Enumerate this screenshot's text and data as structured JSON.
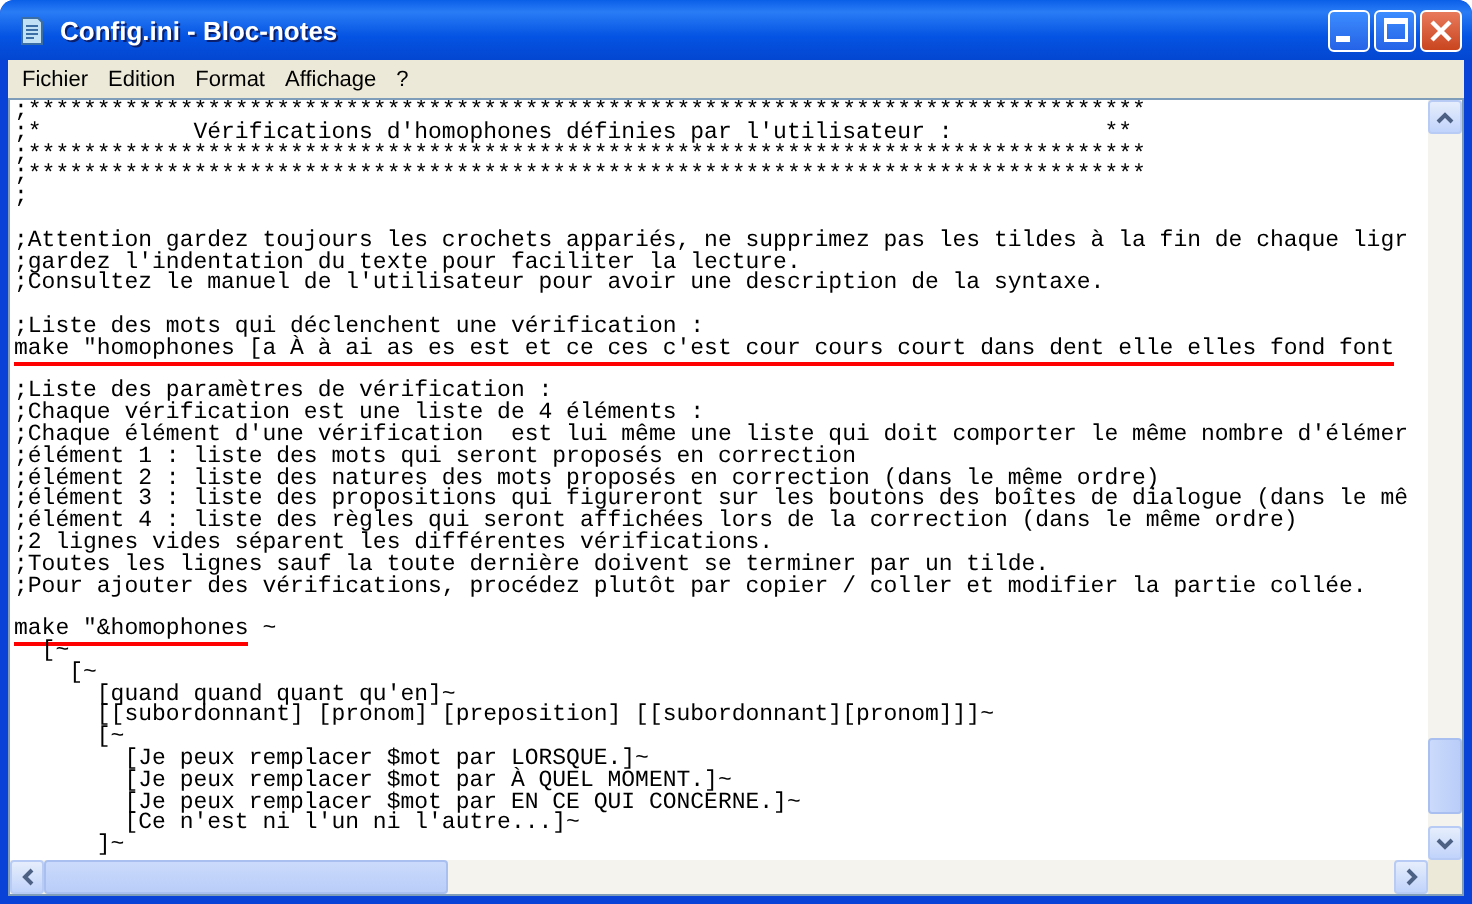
{
  "window": {
    "title": "Config.ini - Bloc-notes"
  },
  "menu": [
    {
      "label": "Fichier"
    },
    {
      "label": "Edition"
    },
    {
      "label": "Format"
    },
    {
      "label": "Affichage"
    },
    {
      "label": "?"
    }
  ],
  "editor": {
    "lines": [
      {
        "kind": "text",
        "text": ";*********************************************************************************"
      },
      {
        "kind": "text",
        "text": ";*           Vérifications d'homophones définies par l'utilisateur :           **"
      },
      {
        "kind": "text",
        "text": ";*********************************************************************************"
      },
      {
        "kind": "text",
        "text": ";*********************************************************************************"
      },
      {
        "kind": "text",
        "text": ";"
      },
      {
        "kind": "blank"
      },
      {
        "kind": "text",
        "text": ";Attention gardez toujours les crochets appariés, ne supprimez pas les tildes à la fin de chaque ligr"
      },
      {
        "kind": "text",
        "text": ";gardez l'indentation du texte pour faciliter la lecture."
      },
      {
        "kind": "text",
        "text": ";Consultez le manuel de l'utilisateur pour avoir une description de la syntaxe."
      },
      {
        "kind": "blank"
      },
      {
        "kind": "text",
        "text": ";Liste des mots qui déclenchent une vérification :"
      },
      {
        "kind": "segments",
        "segments": [
          {
            "text": "make \"homophones [a À à ai as es est et ce ces c'est cour cours court dans dent elle elles fond font",
            "underlined": true
          }
        ]
      },
      {
        "kind": "blank"
      },
      {
        "kind": "text",
        "text": ";Liste des paramètres de vérification :"
      },
      {
        "kind": "text",
        "text": ";Chaque vérification est une liste de 4 éléments :"
      },
      {
        "kind": "text",
        "text": ";Chaque élément d'une vérification  est lui même une liste qui doit comporter le même nombre d'élémer"
      },
      {
        "kind": "text",
        "text": ";élément 1 : liste des mots qui seront proposés en correction"
      },
      {
        "kind": "text",
        "text": ";élément 2 : liste des natures des mots proposés en correction (dans le même ordre)"
      },
      {
        "kind": "text",
        "text": ";élément 3 : liste des propositions qui figureront sur les boutons des boîtes de dialogue (dans le mê"
      },
      {
        "kind": "text",
        "text": ";élément 4 : liste des règles qui seront affichées lors de la correction (dans le même ordre)"
      },
      {
        "kind": "text",
        "text": ";2 lignes vides séparent les différentes vérifications."
      },
      {
        "kind": "text",
        "text": ";Toutes les lignes sauf la toute dernière doivent se terminer par un tilde."
      },
      {
        "kind": "text",
        "text": ";Pour ajouter des vérifications, procédez plutôt par copier / coller et modifier la partie collée."
      },
      {
        "kind": "blank"
      },
      {
        "kind": "segments",
        "segments": [
          {
            "text": "make \"&homophones",
            "underlined": true
          },
          {
            "text": " ~",
            "underlined": false
          }
        ]
      },
      {
        "kind": "text",
        "text": "  [~"
      },
      {
        "kind": "text",
        "text": "    [~"
      },
      {
        "kind": "text",
        "text": "      [quand quand quant qu'en]~"
      },
      {
        "kind": "text",
        "text": "      [[subordonnant] [pronom] [preposition] [[subordonnant][pronom]]]~"
      },
      {
        "kind": "text",
        "text": "      [~"
      },
      {
        "kind": "text",
        "text": "        [Je peux remplacer $mot par LORSQUE.]~"
      },
      {
        "kind": "text",
        "text": "        [Je peux remplacer $mot par À QUEL MOMENT.]~"
      },
      {
        "kind": "text",
        "text": "        [Je peux remplacer $mot par EN CE QUI CONCERNE.]~"
      },
      {
        "kind": "text",
        "text": "        [Ce n'est ni l'un ni l'autre...]~"
      },
      {
        "kind": "text",
        "text": "      ]~"
      }
    ]
  }
}
